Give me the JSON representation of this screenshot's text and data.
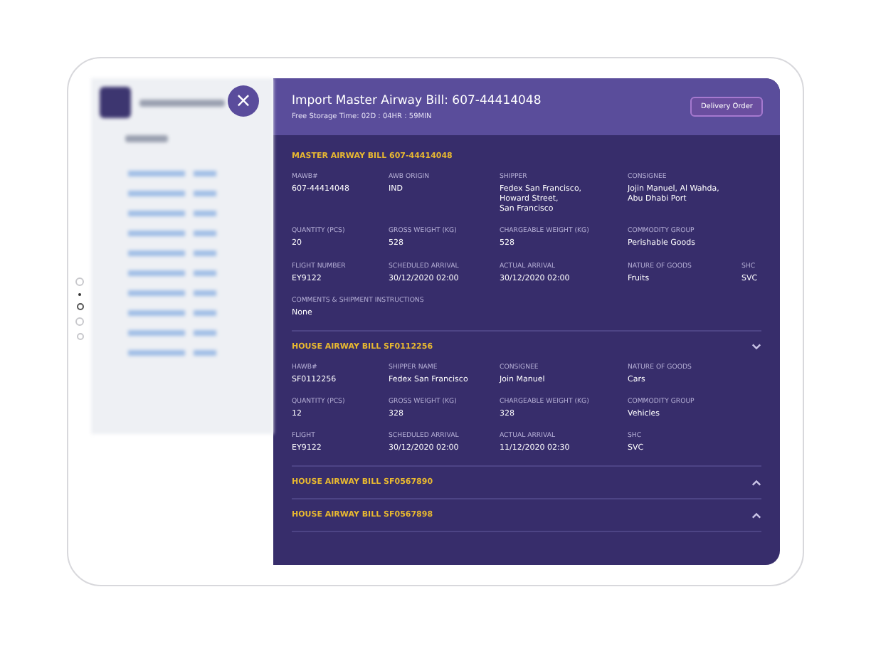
{
  "close_button": {
    "label": "×"
  },
  "panel": {
    "title": "Import Master Airway Bill: 607-44414048",
    "subtitle": "Free Storage Time: 02D : 04HR : 59MIN",
    "action": "Delivery Order"
  },
  "master": {
    "title": "MASTER AIRWAY BILL 607-44414048",
    "rows": [
      [
        {
          "label": "MAWB#",
          "value": "607-44414048"
        },
        {
          "label": "AWB ORIGIN",
          "value": "IND"
        },
        {
          "label": "SHIPPER",
          "value": "Fedex San Francisco,\nHoward Street,\nSan Francisco"
        },
        {
          "label": "CONSIGNEE",
          "value": "Jojin Manuel, Al Wahda,\nAbu Dhabi Port"
        }
      ],
      [
        {
          "label": "QUANTITY (PCS)",
          "value": "20"
        },
        {
          "label": "GROSS WEIGHT (KG)",
          "value": "528"
        },
        {
          "label": "CHARGEABLE WEIGHT (KG)",
          "value": "528"
        },
        {
          "label": "COMMODITY GROUP",
          "value": "Perishable Goods"
        }
      ],
      [
        {
          "label": "FLIGHT NUMBER",
          "value": "EY9122"
        },
        {
          "label": "SCHEDULED ARRIVAL",
          "value": "30/12/2020 02:00"
        },
        {
          "label": "ACTUAL ARRIVAL",
          "value": "30/12/2020 02:00"
        },
        {
          "label": "NATURE OF GOODS",
          "value": "Fruits"
        },
        {
          "label": "SHC",
          "value": "SVC"
        }
      ],
      [
        {
          "label": "COMMENTS & SHIPMENT INSTRUCTIONS",
          "value": "None"
        }
      ]
    ]
  },
  "houses": [
    {
      "title": "HOUSE AIRWAY BILL SF0112256",
      "expanded": true,
      "rows": [
        [
          {
            "label": "HAWB#",
            "value": "SF0112256"
          },
          {
            "label": "SHIPPER NAME",
            "value": "Fedex San Francisco"
          },
          {
            "label": "CONSIGNEE",
            "value": "Join Manuel"
          },
          {
            "label": "NATURE OF GOODS",
            "value": "Cars"
          }
        ],
        [
          {
            "label": "QUANTITY (PCS)",
            "value": "12"
          },
          {
            "label": "GROSS WEIGHT (KG)",
            "value": "328"
          },
          {
            "label": "CHARGEABLE WEIGHT (KG)",
            "value": "328"
          },
          {
            "label": "COMMODITY GROUP",
            "value": "Vehicles"
          }
        ],
        [
          {
            "label": "FLIGHT",
            "value": "EY9122"
          },
          {
            "label": "SCHEDULED ARRIVAL",
            "value": "30/12/2020 02:00"
          },
          {
            "label": "ACTUAL ARRIVAL",
            "value": "11/12/2020 02:30"
          },
          {
            "label": "SHC",
            "value": "SVC"
          }
        ]
      ]
    },
    {
      "title": "HOUSE AIRWAY BILL SF0567890",
      "expanded": false
    },
    {
      "title": "HOUSE AIRWAY BILL SF0567898",
      "expanded": false
    }
  ]
}
